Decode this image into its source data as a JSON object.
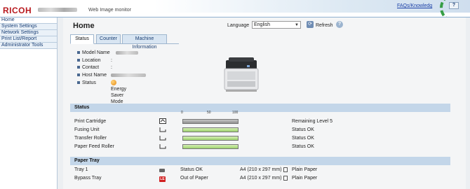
{
  "header": {
    "brand": "RICOH",
    "subtitle": "Web Image monitor",
    "faq_link": "FAQs/Knowledg",
    "help_label": "?"
  },
  "sidebar": {
    "items": [
      {
        "label": "Home"
      },
      {
        "label": "System Settings"
      },
      {
        "label": "Network Settings"
      },
      {
        "label": "Print List/Report"
      },
      {
        "label": "Administrator Tools"
      }
    ]
  },
  "main": {
    "title": "Home",
    "language_label": "Language",
    "language_value": "English",
    "refresh_label": "Refresh",
    "tabs": [
      {
        "label": "Status"
      },
      {
        "label": "Counter"
      },
      {
        "label": "Machine Information"
      }
    ],
    "device_info": {
      "model_name_label": "Model Name",
      "location_label": "Location",
      "location_value": ":",
      "contact_label": "Contact",
      "contact_value": ":",
      "host_name_label": "Host Name",
      "status_label": "Status",
      "status_value": "Energy Saver Mode 2"
    },
    "status_section": {
      "title": "Status",
      "scale_ticks": [
        "0",
        "50",
        "100"
      ],
      "rows": [
        {
          "label": "Print Cartridge",
          "status": "Remaining Level 5",
          "level": 1.0,
          "bar_style": "gray"
        },
        {
          "label": "Fusing Unit",
          "status": "Status OK",
          "level": 1.0,
          "bar_style": "green"
        },
        {
          "label": "Transfer Roller",
          "status": "Status OK",
          "level": 1.0,
          "bar_style": "green"
        },
        {
          "label": "Paper Feed Roller",
          "status": "Status OK",
          "level": 1.0,
          "bar_style": "green"
        }
      ]
    },
    "paper_tray_section": {
      "title": "Paper Tray",
      "rows": [
        {
          "label": "Tray 1",
          "status": "Status OK",
          "size": "A4 (210 x 297 mm)",
          "type": "Plain Paper"
        },
        {
          "label": "Bypass Tray",
          "status": "Out of Paper",
          "size": "A4 (210 x 297 mm)",
          "type": "Plain Paper"
        }
      ]
    }
  },
  "colors": {
    "brand_red": "#b8191e",
    "link_blue": "#1a3fa6",
    "section_header": "#c3d6e9",
    "ok_green": "#9cd26c",
    "error_red": "#d12020"
  }
}
